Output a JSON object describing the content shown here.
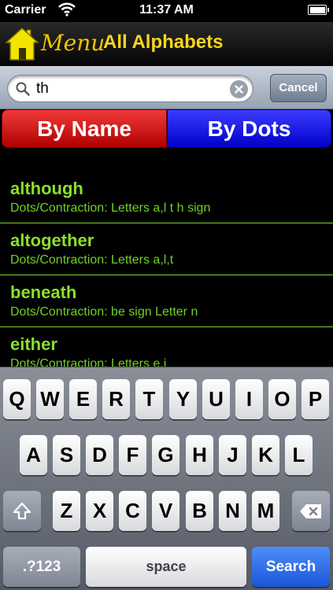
{
  "status_bar": {
    "carrier": "Carrier",
    "time": "11:37 AM"
  },
  "nav": {
    "menu_label": "Menu",
    "title": "All Alphabets"
  },
  "search": {
    "value": "th",
    "placeholder": "",
    "cancel_label": "Cancel"
  },
  "segments": {
    "by_name": "By Name",
    "by_dots": "By Dots",
    "selected": "By Dots"
  },
  "results": [
    {
      "word": "although",
      "detail": "Dots/Contraction: Letters a,l t h sign"
    },
    {
      "word": "altogether",
      "detail": "Dots/Contraction: Letters a,l,t"
    },
    {
      "word": "beneath",
      "detail": "Dots/Contraction: be sign Letter n"
    },
    {
      "word": "either",
      "detail": "Dots/Contraction: Letters e,i"
    }
  ],
  "keyboard": {
    "row1": [
      "Q",
      "W",
      "E",
      "R",
      "T",
      "Y",
      "U",
      "I",
      "O",
      "P"
    ],
    "row2": [
      "A",
      "S",
      "D",
      "F",
      "G",
      "H",
      "J",
      "K",
      "L"
    ],
    "row3": [
      "Z",
      "X",
      "C",
      "V",
      "B",
      "N",
      "M"
    ],
    "numbers_label": ".?123",
    "space_label": "space",
    "search_label": "Search"
  },
  "colors": {
    "nav_title": "#f7d61c",
    "result_text": "#8ae02a",
    "by_name_segment": "#d41414",
    "by_dots_segment": "#1e1ee8",
    "search_key": "#2a66e8"
  },
  "icons": [
    "wifi-icon",
    "battery-icon",
    "home-icon",
    "search-icon",
    "clear-icon",
    "shift-icon",
    "delete-icon"
  ]
}
